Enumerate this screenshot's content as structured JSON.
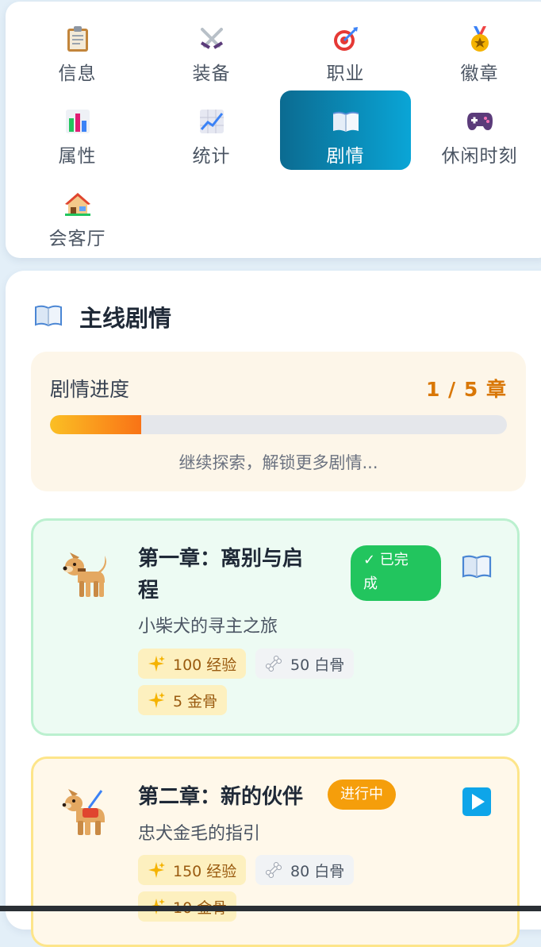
{
  "nav": {
    "items": [
      {
        "label": "信息",
        "icon": "clipboard-icon"
      },
      {
        "label": "装备",
        "icon": "crossed-swords-icon"
      },
      {
        "label": "职业",
        "icon": "target-icon"
      },
      {
        "label": "徽章",
        "icon": "medal-icon"
      },
      {
        "label": "属性",
        "icon": "bar-chart-icon"
      },
      {
        "label": "统计",
        "icon": "line-chart-icon"
      },
      {
        "label": "剧情",
        "icon": "open-book-icon",
        "active": true
      },
      {
        "label": "休闲时刻",
        "icon": "gamepad-icon"
      },
      {
        "label": "会客厅",
        "icon": "house-icon"
      }
    ]
  },
  "main": {
    "title": "主线剧情",
    "progress": {
      "label": "剧情进度",
      "value_text": "1 / 5 章",
      "completed": 1,
      "total": 5,
      "hint": "继续探索，解锁更多剧情..."
    },
    "chapters": [
      {
        "title_line1": "第一章：离别与启",
        "title_line2": "程",
        "subtitle": "小柴犬的寻主之旅",
        "status": "✓ 已完成",
        "status_line1": "✓ 已完",
        "status_line2": "成",
        "action_icon": "open-book-icon",
        "rewards": [
          {
            "text": "100 经验",
            "icon": "sparkles-icon",
            "style": "gold"
          },
          {
            "text": "50 白骨",
            "icon": "bone-icon",
            "style": "gray"
          },
          {
            "text": "5 金骨",
            "icon": "sparkles-icon",
            "style": "gold"
          }
        ]
      },
      {
        "title": "第二章：新的伙伴",
        "subtitle": "忠犬金毛的指引",
        "status": "进行中",
        "action_icon": "play-icon",
        "rewards": [
          {
            "text": "150 经验",
            "icon": "sparkles-icon",
            "style": "gold"
          },
          {
            "text": "80 白骨",
            "icon": "bone-icon",
            "style": "gray"
          },
          {
            "text": "10 金骨",
            "icon": "sparkles-icon",
            "style": "gold"
          }
        ]
      }
    ]
  },
  "colors": {
    "accent_start": "#0b6b91",
    "accent_end": "#0aa5d6",
    "progress_orange": "#d97706",
    "done_green": "#22c55e",
    "in_progress_amber": "#f59e0b"
  }
}
